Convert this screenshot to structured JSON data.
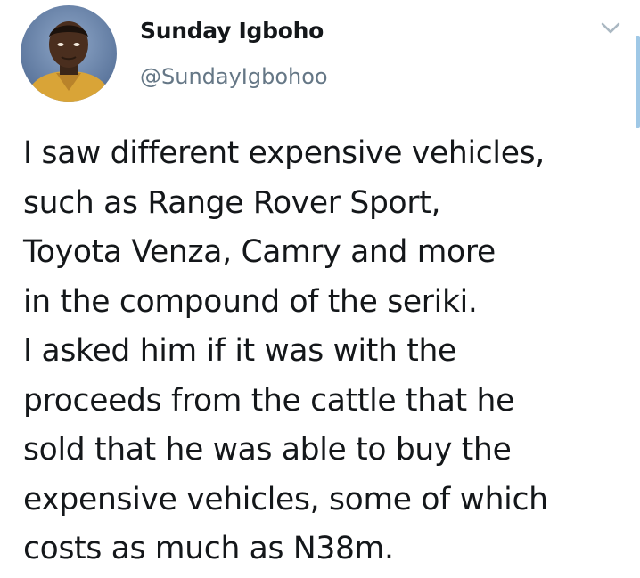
{
  "author": {
    "display_name": "Sunday Igboho",
    "handle": "@SundayIgbohoo",
    "avatar_icon": "profile-photo"
  },
  "menu": {
    "icon": "chevron-down-icon"
  },
  "tweet": {
    "lines": [
      "I saw different expensive vehicles,",
      "such as Range Rover Sport,",
      "Toyota Venza, Camry and more",
      "in the compound of the seriki.",
      "I asked him if it was with the",
      "proceeds from the cattle that he",
      "sold that he was able to buy the",
      "expensive vehicles, some of which",
      "costs as much as N38m."
    ]
  },
  "colors": {
    "text": "#14171a",
    "secondary": "#657786",
    "accent": "#9fc8e6"
  }
}
